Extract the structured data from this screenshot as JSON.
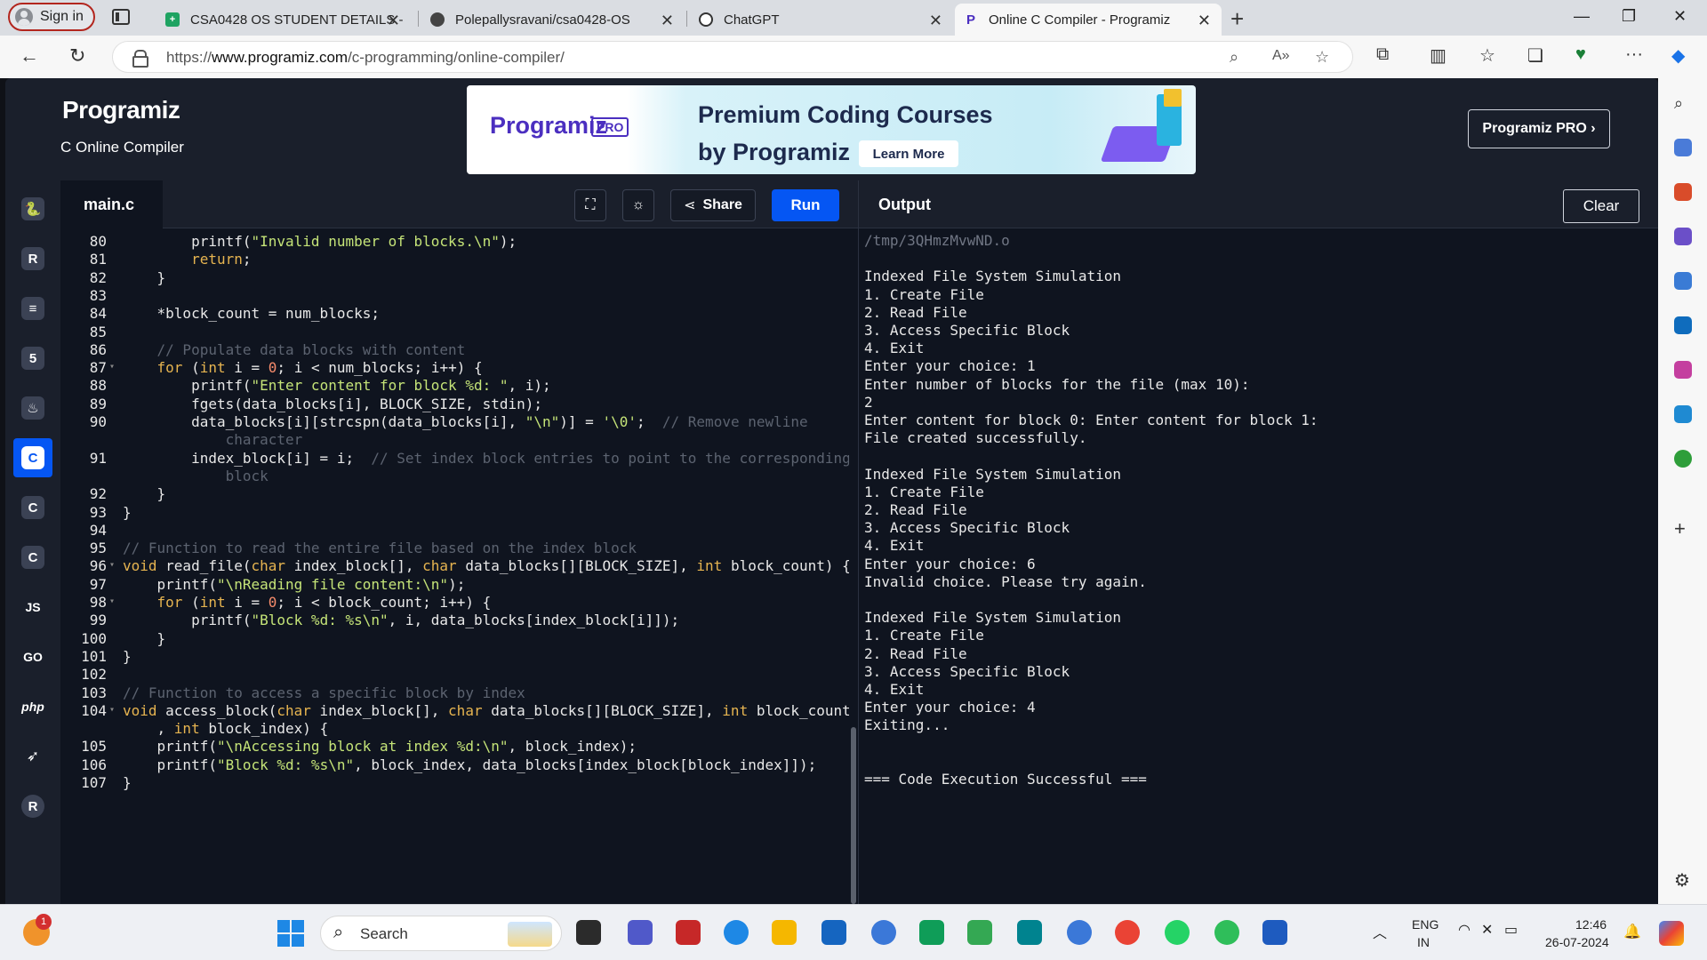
{
  "browser": {
    "signin_label": "Sign in",
    "tabs": [
      {
        "title": "CSA0428 OS STUDENT DETAILS -",
        "icon": "sheets-icon"
      },
      {
        "title": "Polepallysravani/csa0428-OS",
        "icon": "github-icon"
      },
      {
        "title": "ChatGPT",
        "icon": "chatgpt-icon"
      },
      {
        "title": "Online C Compiler - Programiz",
        "icon": "programiz-icon",
        "active": true
      }
    ],
    "url_prefix": "https://",
    "url_host": "www.programiz.com",
    "url_path": "/c-programming/online-compiler/"
  },
  "header": {
    "logo": "Programiz",
    "subtitle": "C Online Compiler",
    "banner": {
      "logo": "Programiz",
      "pro_badge": "PRO",
      "line1": "Premium Coding Courses",
      "line2": "by Programiz",
      "cta": "Learn More"
    },
    "pro_button": "Programiz PRO ›"
  },
  "languages": [
    "python",
    "r",
    "sql",
    "html",
    "java",
    "c",
    "cpp",
    "csharp",
    "js",
    "go",
    "php",
    "swift",
    "rust"
  ],
  "editor": {
    "file_name": "main.c",
    "share_label": "Share",
    "run_label": "Run"
  },
  "code_lines": [
    {
      "n": "80",
      "t": "        printf(\"Invalid number of blocks.\\n\");"
    },
    {
      "n": "81",
      "t": "        return;"
    },
    {
      "n": "82",
      "t": "    }"
    },
    {
      "n": "83",
      "t": ""
    },
    {
      "n": "84",
      "t": "    *block_count = num_blocks;"
    },
    {
      "n": "85",
      "t": ""
    },
    {
      "n": "86",
      "t": "    // Populate data blocks with content"
    },
    {
      "n": "87",
      "t": "    for (int i = 0; i < num_blocks; i++) {"
    },
    {
      "n": "88",
      "t": "        printf(\"Enter content for block %d: \", i);"
    },
    {
      "n": "89",
      "t": "        fgets(data_blocks[i], BLOCK_SIZE, stdin);"
    },
    {
      "n": "90",
      "t": "        data_blocks[i][strcspn(data_blocks[i], \"\\n\")] = '\\0';  // Remove newline"
    },
    {
      "n": "",
      "t": "            character"
    },
    {
      "n": "91",
      "t": "        index_block[i] = i;  // Set index block entries to point to the corresponding"
    },
    {
      "n": "",
      "t": "            block"
    },
    {
      "n": "92",
      "t": "    }"
    },
    {
      "n": "93",
      "t": "}"
    },
    {
      "n": "94",
      "t": ""
    },
    {
      "n": "95",
      "t": "// Function to read the entire file based on the index block"
    },
    {
      "n": "96",
      "t": "void read_file(char index_block[], char data_blocks[][BLOCK_SIZE], int block_count) {"
    },
    {
      "n": "97",
      "t": "    printf(\"\\nReading file content:\\n\");"
    },
    {
      "n": "98",
      "t": "    for (int i = 0; i < block_count; i++) {"
    },
    {
      "n": "99",
      "t": "        printf(\"Block %d: %s\\n\", i, data_blocks[index_block[i]]);"
    },
    {
      "n": "100",
      "t": "    }"
    },
    {
      "n": "101",
      "t": "}"
    },
    {
      "n": "102",
      "t": ""
    },
    {
      "n": "103",
      "t": "// Function to access a specific block by index"
    },
    {
      "n": "104",
      "t": "void access_block(char index_block[], char data_blocks[][BLOCK_SIZE], int block_count"
    },
    {
      "n": "",
      "t": "    , int block_index) {"
    },
    {
      "n": "105",
      "t": "    printf(\"\\nAccessing block at index %d:\\n\", block_index);"
    },
    {
      "n": "106",
      "t": "    printf(\"Block %d: %s\\n\", block_index, data_blocks[index_block[block_index]]);"
    },
    {
      "n": "107",
      "t": "}"
    }
  ],
  "output": {
    "title": "Output",
    "clear_label": "Clear",
    "lines": [
      "/tmp/3QHmzMvwND.o",
      "",
      "Indexed File System Simulation",
      "1. Create File",
      "2. Read File",
      "3. Access Specific Block",
      "4. Exit",
      "Enter your choice: 1",
      "Enter number of blocks for the file (max 10):",
      "2",
      "Enter content for block 0: Enter content for block 1:",
      "File created successfully.",
      "",
      "Indexed File System Simulation",
      "1. Create File",
      "2. Read File",
      "3. Access Specific Block",
      "4. Exit",
      "Enter your choice: 6",
      "Invalid choice. Please try again.",
      "",
      "Indexed File System Simulation",
      "1. Create File",
      "2. Read File",
      "3. Access Specific Block",
      "4. Exit",
      "Enter your choice: 4",
      "Exiting...",
      "",
      "",
      "=== Code Execution Successful ==="
    ]
  },
  "taskbar": {
    "search_label": "Search",
    "lang_line1": "ENG",
    "lang_line2": "IN",
    "time": "12:46",
    "date": "26-07-2024",
    "notification_count": "1"
  },
  "colors": {
    "accent": "#0556f3",
    "panel": "#1a1f2b",
    "editor_bg": "#0f141f"
  }
}
